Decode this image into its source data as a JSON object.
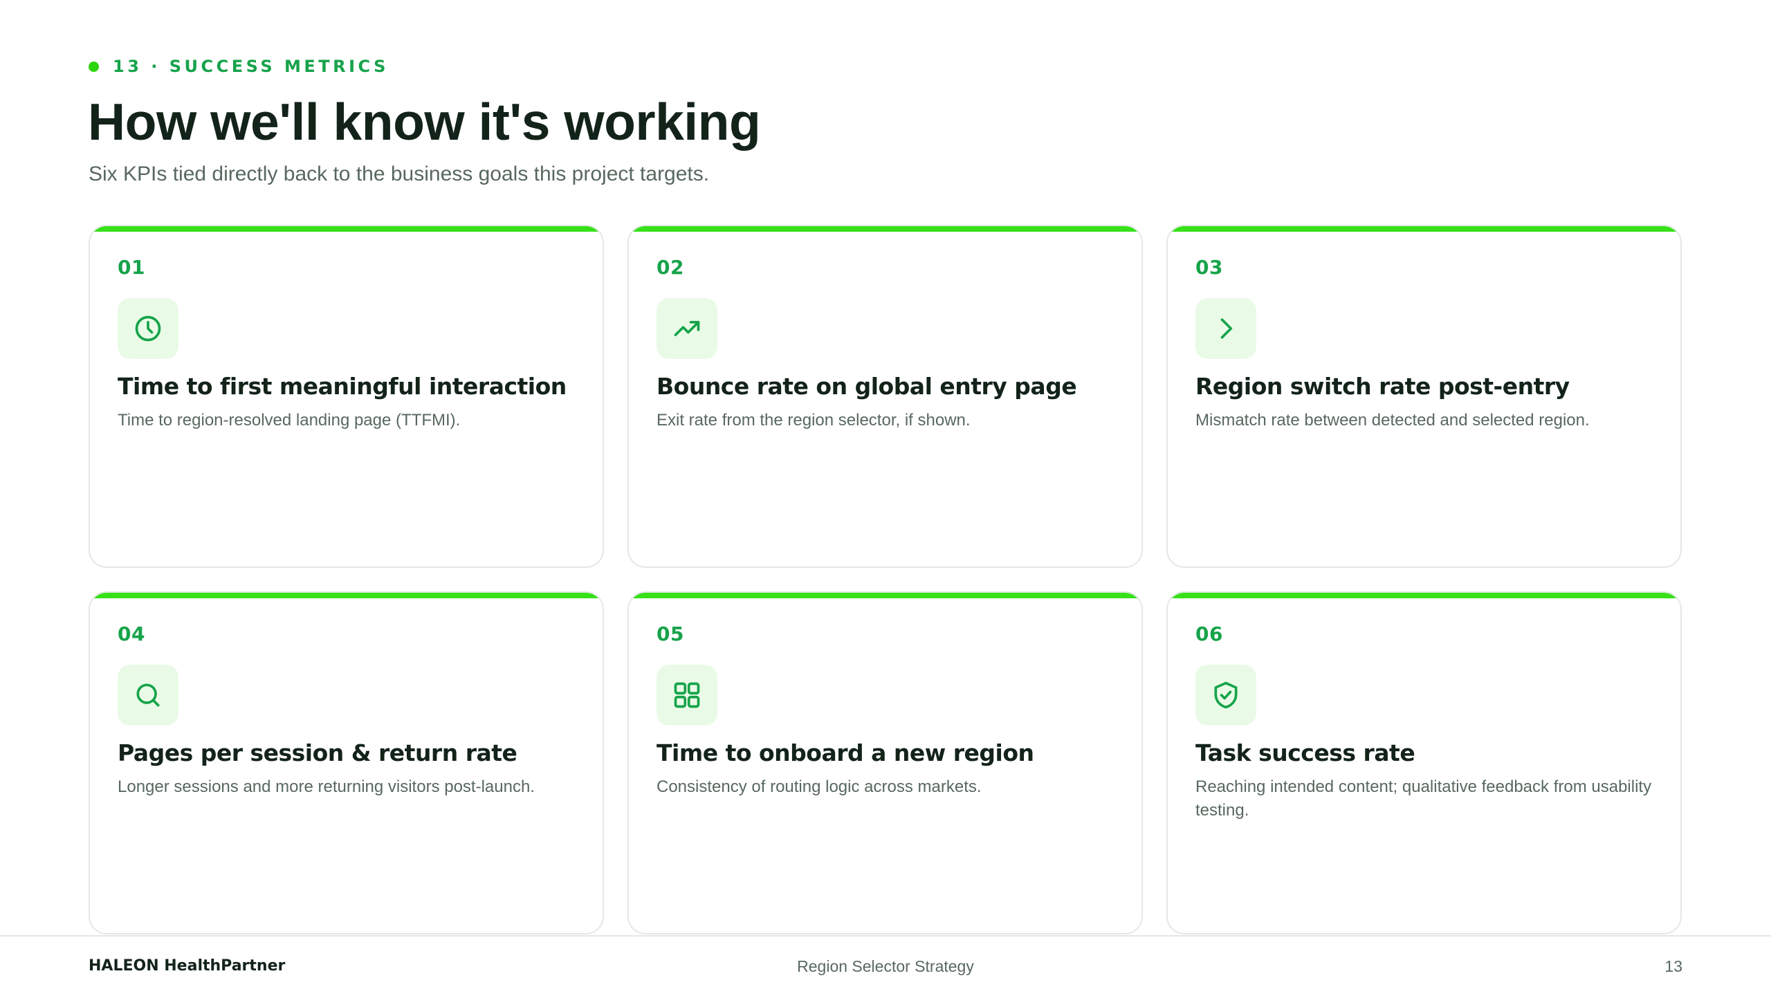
{
  "slide": {
    "eyebrow": "13 · SUCCESS METRICS",
    "title": "How we'll know it's working",
    "subtitle": "Six KPIs tied directly back to the business goals this project targets."
  },
  "cards": [
    {
      "number": "01",
      "icon": "clock-icon",
      "title": "Time to first meaningful interaction",
      "description": "Time to region-resolved landing page (TTFMI)."
    },
    {
      "number": "02",
      "icon": "trending-up-icon",
      "title": "Bounce rate on global entry page",
      "description": "Exit rate from the region selector, if shown."
    },
    {
      "number": "03",
      "icon": "chevron-right-icon",
      "title": "Region switch rate post-entry",
      "description": "Mismatch rate between detected and selected region."
    },
    {
      "number": "04",
      "icon": "search-icon",
      "title": "Pages per session & return rate",
      "description": "Longer sessions and more returning visitors post-launch."
    },
    {
      "number": "05",
      "icon": "grid-icon",
      "title": "Time to onboard a new region",
      "description": "Consistency of routing logic across markets."
    },
    {
      "number": "06",
      "icon": "shield-check-icon",
      "title": "Task success rate",
      "description": "Reaching intended content; qualitative feedback from usability testing."
    }
  ],
  "footer": {
    "logo": "HALEON HealthPartner",
    "center": "Region Selector Strategy",
    "page": "13"
  },
  "colors": {
    "accent": "#36e118",
    "accent_text": "#16a34a",
    "icon_bg": "#e9fbe6",
    "heading": "#13231a",
    "body": "#58685f"
  }
}
